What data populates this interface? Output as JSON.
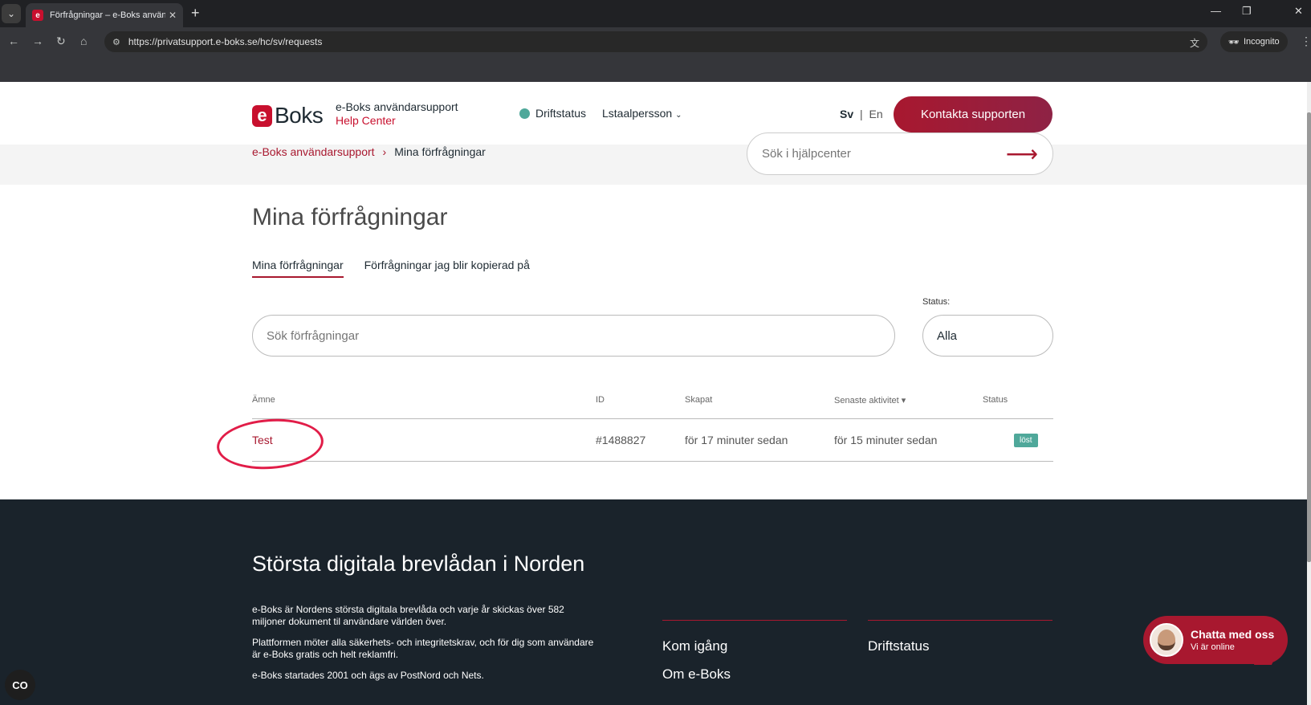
{
  "browser": {
    "tab_title": "Förfrågningar – e-Boks använda",
    "tab_favicon": "e",
    "tab_close": "✕",
    "new_tab": "+",
    "url": "https://privatsupport.e-boks.se/hc/sv/requests",
    "incognito_label": "Incognito",
    "icons": [
      "back-icon",
      "forward-icon",
      "reload-icon",
      "home-icon",
      "site-info-icon",
      "translate-icon",
      "incognito-icon",
      "menu-icon"
    ]
  },
  "header": {
    "logo_e": "e",
    "logo_text": "Boks",
    "brand_title": "e-Boks användarsupport",
    "brand_sub": "Help Center",
    "status_link": "Driftstatus",
    "user_menu": "Lstaalpersson",
    "lang_sv": "Sv",
    "lang_sep": "|",
    "lang_en": "En",
    "contact_button": "Kontakta supporten"
  },
  "breadcrumb": {
    "home": "e-Boks användarsupport",
    "separator": "›",
    "current": "Mina förfrågningar"
  },
  "hc_search": {
    "placeholder": "Sök i hjälpcenter"
  },
  "main": {
    "title": "Mina förfrågningar",
    "tabs": [
      {
        "label": "Mina förfrågningar",
        "active": true
      },
      {
        "label": "Förfrågningar jag blir kopierad på",
        "active": false
      }
    ],
    "search_placeholder": "Sök förfrågningar",
    "status_label": "Status:",
    "status_value": "Alla"
  },
  "table": {
    "headers": {
      "subject": "Ämne",
      "id": "ID",
      "created": "Skapat",
      "last_activity": "Senaste aktivitet ▾",
      "status": "Status"
    },
    "rows": [
      {
        "subject": "Test",
        "id": "#1488827",
        "created": "för 17 minuter sedan",
        "last_activity": "för 15 minuter sedan",
        "status": "löst"
      }
    ]
  },
  "footer": {
    "title": "Största digitala brevlådan i Norden",
    "paragraphs": [
      "e-Boks är Nordens största digitala brevlåda och varje år skickas över 582 miljoner dokument til användare världen över.",
      "Plattformen möter alla säkerhets- och integritetskrav, och för dig som användare är e-Boks gratis och helt reklamfri.",
      "e-Boks startades 2001 och ägs av PostNord och Nets."
    ],
    "col1": [
      "Kom igång",
      "Om e-Boks"
    ],
    "col2": [
      "Driftstatus"
    ]
  },
  "chat": {
    "title": "Chatta med oss",
    "subtitle": "Vi är online"
  },
  "cookie_button": "CO",
  "colors": {
    "brand_red": "#a8182f",
    "status_teal": "#4fa89a",
    "footer_bg": "#1a232b",
    "annotation_red": "#e11d48"
  }
}
